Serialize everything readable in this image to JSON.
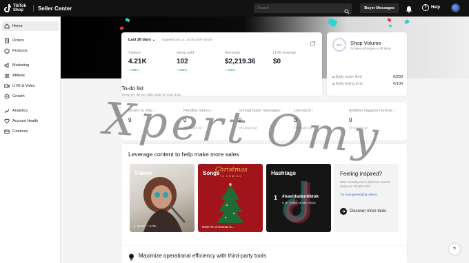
{
  "topbar": {
    "logo_text": "TikTok Shop",
    "app_title": "Seller Center",
    "search_placeholder": "Search",
    "buyer_messages": "Buyer Messages",
    "help": "Help",
    "help_symbol": "?"
  },
  "sidebar": {
    "items": [
      {
        "label": "Home",
        "icon": "home-icon"
      },
      {
        "label": "Orders",
        "icon": "orders-icon"
      },
      {
        "label": "Products",
        "icon": "products-icon"
      },
      {
        "label": "Marketing",
        "icon": "marketing-icon"
      },
      {
        "label": "Affiliate",
        "icon": "affiliate-icon"
      },
      {
        "label": "LIVE & Video",
        "icon": "live-video-icon"
      },
      {
        "label": "Growth",
        "icon": "growth-icon"
      },
      {
        "label": "Analytics",
        "icon": "analytics-icon"
      },
      {
        "label": "Account Health",
        "icon": "account-health-icon"
      },
      {
        "label": "Finances",
        "icon": "finances-icon"
      }
    ]
  },
  "stats": {
    "range": "Last 28 days",
    "updated": "Updated Dec 16, 16:00 (GMT-08:00)",
    "metrics": [
      {
        "label": "Visitors",
        "value": "4.21K",
        "change": "+ 458%"
      },
      {
        "label": "Items sold",
        "value": "102",
        "change": "+ 580%"
      },
      {
        "label": "Revenue",
        "value": "$2,219.36",
        "change": "+ 485%"
      },
      {
        "label": "LIVE revenue",
        "value": "$0",
        "change": ""
      }
    ]
  },
  "shop_volume": {
    "circle": "0/4",
    "title": "Shop Volume",
    "subtitle": "Achieve all targets to lift limits",
    "limits": [
      {
        "label": "Daily order limit",
        "value": "0/200"
      },
      {
        "label": "Daily listing limit",
        "value": "0/100"
      }
    ]
  },
  "todo": {
    "title": "To-do list",
    "subtitle": "These are the key daily tasks for your shop.",
    "items": [
      {
        "label": "Orders to ship",
        "value": "9",
        "status": ""
      },
      {
        "label": "Pending returns",
        "value": "0",
        "status": "All caught up!"
      },
      {
        "label": "Unread buyer messages",
        "value": "0",
        "status": "All caught up!"
      },
      {
        "label": "Low stock",
        "value": "0",
        "status": "All caught up!"
      },
      {
        "label": "Address negative reviews",
        "value": "0",
        "status": "All caught up!"
      }
    ]
  },
  "content": {
    "title": "Leverage content to help make more sales",
    "tiles": [
      {
        "label": "Videos",
        "caption": "▷ 16.7K   ♡ 2.7K"
      },
      {
        "label": "Songs",
        "caption": "Rank #1   Christmas is..."
      },
      {
        "label": "Hashtags",
        "caption": ""
      }
    ],
    "songs_art_title": "Christmas",
    "songs_art_sub": "IS COMING",
    "hashtag_rank": "1",
    "hashtag_name": "#navidadentiktok",
    "hashtag_stats": "6.1K Posts  49.6M Views",
    "inspire_title": "Feeling inspired?",
    "inspire_body": "Start creating more effective content using our simple tools.",
    "inspire_link": "Try auto-generating videos.",
    "discover": "Discover more tools"
  },
  "bottom": {
    "title": "Maximize operational efficiency with third-party tools"
  },
  "watermark": "Xpert Omy",
  "float_help": "?"
}
